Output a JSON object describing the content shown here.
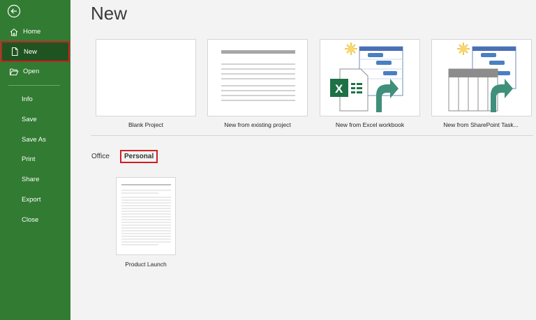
{
  "sidebar": {
    "items": [
      {
        "label": "Home",
        "icon": "home-icon"
      },
      {
        "label": "New",
        "icon": "document-icon"
      },
      {
        "label": "Open",
        "icon": "folder-open-icon"
      },
      {
        "label": "Info"
      },
      {
        "label": "Save"
      },
      {
        "label": "Save As"
      },
      {
        "label": "Print"
      },
      {
        "label": "Share"
      },
      {
        "label": "Export"
      },
      {
        "label": "Close"
      }
    ]
  },
  "main": {
    "title": "New",
    "tiles": [
      {
        "label": "Blank Project"
      },
      {
        "label": "New from existing project"
      },
      {
        "label": "New from Excel workbook"
      },
      {
        "label": "New from SharePoint Task..."
      }
    ],
    "categories": [
      {
        "label": "Office"
      },
      {
        "label": "Personal"
      }
    ],
    "templates": [
      {
        "label": "Product Launch"
      }
    ]
  },
  "colors": {
    "sidebar_bg": "#317b32",
    "selected_bg": "#1f5421",
    "highlight_border": "#d11e22"
  }
}
